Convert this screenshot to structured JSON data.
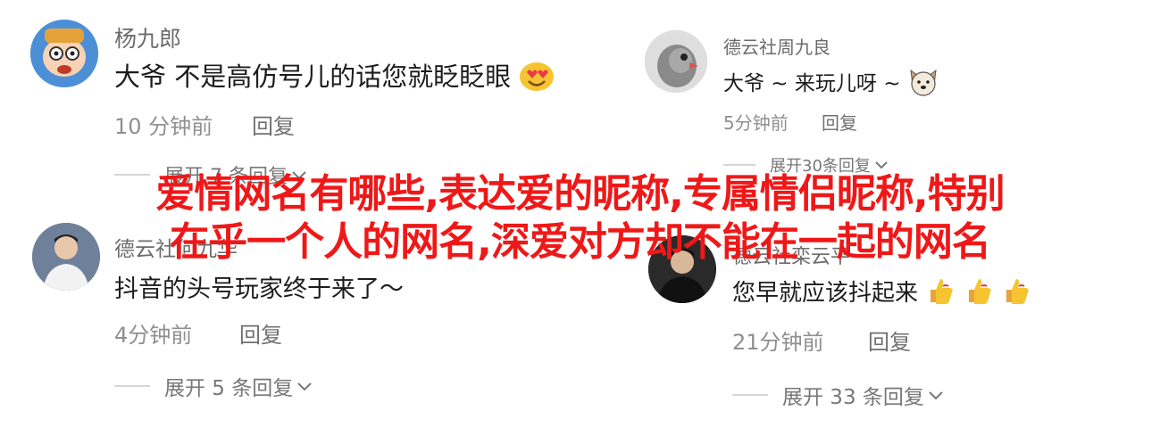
{
  "comments": [
    {
      "username": "杨九郎",
      "text": "大爷 不是高仿号儿的话您就眨眨眼",
      "emoji": "heart-eyes-emoji",
      "time": "10 分钟前",
      "reply": "回复",
      "expand": "展开 7 条回复"
    },
    {
      "username": "德云社周九良",
      "text": "大爷 ~ 来玩儿呀 ~",
      "emoji": "dog-face-emoji",
      "time": "5分钟前",
      "reply": "回复",
      "expand": "展开30条回复"
    },
    {
      "username": "德云社何九华",
      "text": "抖音的头号玩家终于来了～",
      "time": "4分钟前",
      "reply": "回复",
      "expand": "展开 5 条回复"
    },
    {
      "username": "德云社栾云平",
      "text": "您早就应该抖起来",
      "emoji": "thumbs-up-emoji",
      "emoji_count": 3,
      "time": "21分钟前",
      "reply": "回复",
      "expand": "展开 33 条回复"
    }
  ],
  "overlay_title": {
    "line1": "爱情网名有哪些,表达爱的昵称,专属情侣昵称,特别",
    "line2": "在乎一个人的网名,深爱对方却不能在一起的网名",
    "color": "#ef1818"
  },
  "colors": {
    "text": "#1c1c1c",
    "username": "#6b6b6b",
    "meta": "#8f8f8f",
    "background": "#ffffff"
  }
}
